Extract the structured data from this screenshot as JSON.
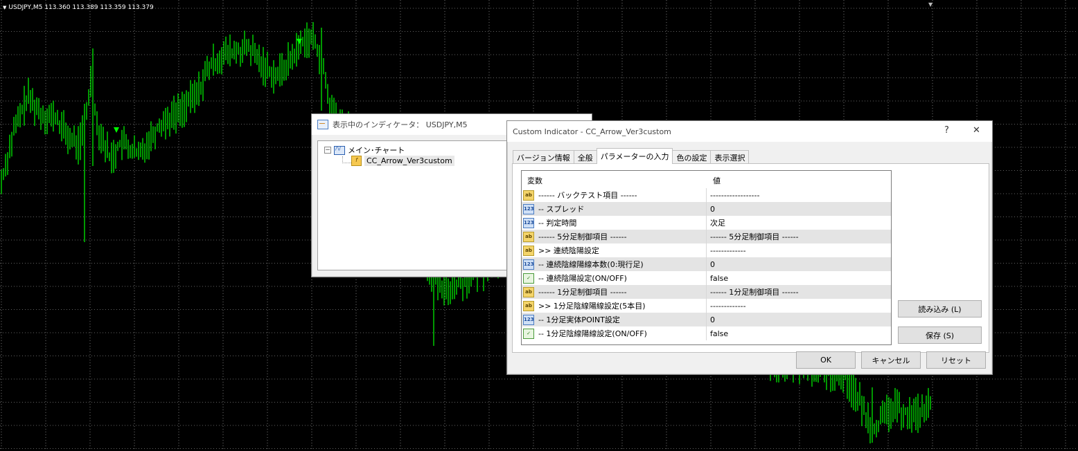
{
  "chart": {
    "symbol_label": "USDJPY,M5",
    "ohlc": "113.360 113.389 113.359 113.379",
    "colors": {
      "background": "#000000",
      "bars": "#00ff00",
      "grid": "#c8c8c8"
    }
  },
  "indicators_window": {
    "title": "表示中のインディケータ： USDJPY,M5",
    "tree": {
      "root": "メイン･チャート",
      "child": "CC_Arrow_Ver3custom"
    }
  },
  "custom_indicator_dialog": {
    "title": "Custom Indicator - CC_Arrow_Ver3custom",
    "help_label": "?",
    "close_label": "✕",
    "tabs": [
      "バージョン情報",
      "全般",
      "パラメーターの入力",
      "色の設定",
      "表示選択"
    ],
    "active_tab": "パラメーターの入力",
    "table": {
      "col_variable": "変数",
      "col_value": "値",
      "rows": [
        {
          "icon": "ab",
          "name": "------ バックテスト項目 ------",
          "value": "------------------"
        },
        {
          "icon": "num",
          "name": "-- スプレッド",
          "value": "0"
        },
        {
          "icon": "num",
          "name": "-- 判定時間",
          "value": "次足"
        },
        {
          "icon": "ab",
          "name": "------ 5分足制御項目 ------",
          "value": "------ 5分足制御項目 ------"
        },
        {
          "icon": "ab",
          "name": ">> 連続陰陽設定",
          "value": "-------------"
        },
        {
          "icon": "num",
          "name": "-- 連続陰線陽線本数(0:現行足)",
          "value": "0"
        },
        {
          "icon": "bool",
          "name": "-- 連続陰陽設定(ON/OFF)",
          "value": "false"
        },
        {
          "icon": "ab",
          "name": "------ 1分足制御項目 ------",
          "value": "------ 1分足制御項目 ------"
        },
        {
          "icon": "ab",
          "name": ">> 1分足陰線陽線設定(5本目)",
          "value": "-------------"
        },
        {
          "icon": "num",
          "name": "-- 1分足実体POINT設定",
          "value": "0"
        },
        {
          "icon": "bool",
          "name": "-- 1分足陰線陽線設定(ON/OFF)",
          "value": "false"
        }
      ]
    },
    "icon_text": {
      "ab": "ab",
      "num": "123",
      "bool": "✓"
    },
    "buttons": {
      "load": "読み込み (L)",
      "save": "保存 (S)",
      "ok": "OK",
      "cancel": "キャンセル",
      "reset": "リセット"
    }
  }
}
